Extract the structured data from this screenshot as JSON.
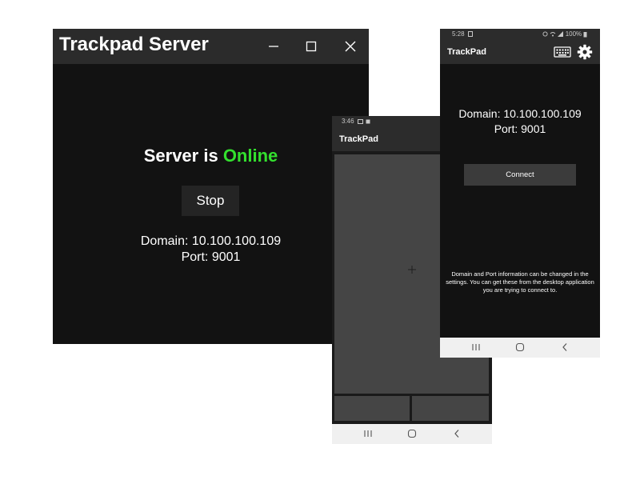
{
  "desktop": {
    "title": "Trackpad Server",
    "status_prefix": "Server is",
    "status_value": "Online",
    "status_color": "#33e02e",
    "stop_label": "Stop",
    "domain": "Domain: 10.100.100.109",
    "port": "Port: 9001"
  },
  "phone_trackpad": {
    "status_time": "3:46",
    "app_title": "TrackPad"
  },
  "phone_connect": {
    "status_time": "5:28",
    "status_battery": "100%",
    "app_title": "TrackPad",
    "domain": "Domain: 10.100.100.109",
    "port": "Port: 9001",
    "connect_label": "Connect",
    "note": "Domain and Port information can be changed in the settings. You can get these from the desktop application you are trying to connect to."
  },
  "icons": [
    "minimize-icon",
    "maximize-icon",
    "close-icon",
    "keyboard-icon",
    "gear-icon",
    "plus-icon",
    "recent-apps-icon",
    "home-icon",
    "back-icon"
  ]
}
